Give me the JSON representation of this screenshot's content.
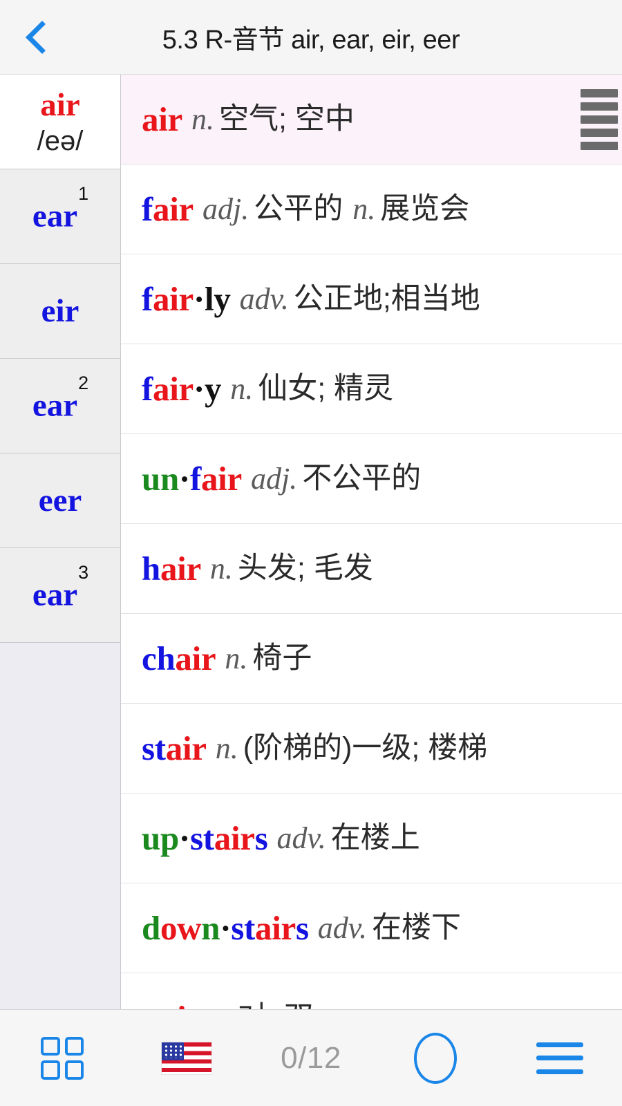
{
  "header": {
    "back_icon": "chevron-left-icon",
    "title": "5.3 R-音节 air, ear, eir, eer"
  },
  "sidebar": {
    "items": [
      {
        "label": "air",
        "sup": "",
        "phonetic": "/eə/",
        "active": true
      },
      {
        "label": "ear",
        "sup": "1",
        "phonetic": "",
        "active": false
      },
      {
        "label": "eir",
        "sup": "",
        "phonetic": "",
        "active": false
      },
      {
        "label": "ear",
        "sup": "2",
        "phonetic": "",
        "active": false
      },
      {
        "label": "eer",
        "sup": "",
        "phonetic": "",
        "active": false
      },
      {
        "label": "ear",
        "sup": "3",
        "phonetic": "",
        "active": false
      }
    ]
  },
  "list": {
    "rows": [
      {
        "selected": true,
        "word_parts": [
          {
            "t": "air",
            "c": "red"
          }
        ],
        "entries": [
          {
            "pos": "n.",
            "mean": "空气; 空中"
          }
        ]
      },
      {
        "selected": false,
        "word_parts": [
          {
            "t": "f",
            "c": "blue"
          },
          {
            "t": "air",
            "c": "red"
          }
        ],
        "entries": [
          {
            "pos": "adj.",
            "mean": "公平的"
          },
          {
            "pos": "n.",
            "mean": "展览会"
          }
        ]
      },
      {
        "selected": false,
        "word_parts": [
          {
            "t": "f",
            "c": "blue"
          },
          {
            "t": "air",
            "c": "red"
          },
          {
            "t": "·",
            "c": "dot"
          },
          {
            "t": "ly",
            "c": "black"
          }
        ],
        "entries": [
          {
            "pos": "adv.",
            "mean": "公正地;相当地"
          }
        ]
      },
      {
        "selected": false,
        "word_parts": [
          {
            "t": "f",
            "c": "blue"
          },
          {
            "t": "air",
            "c": "red"
          },
          {
            "t": "·",
            "c": "dot"
          },
          {
            "t": "y",
            "c": "black"
          }
        ],
        "entries": [
          {
            "pos": "n.",
            "mean": "仙女; 精灵"
          }
        ]
      },
      {
        "selected": false,
        "word_parts": [
          {
            "t": "un",
            "c": "green"
          },
          {
            "t": "·",
            "c": "dot"
          },
          {
            "t": "f",
            "c": "blue"
          },
          {
            "t": "air",
            "c": "red"
          }
        ],
        "entries": [
          {
            "pos": "adj.",
            "mean": "不公平的"
          }
        ]
      },
      {
        "selected": false,
        "word_parts": [
          {
            "t": "h",
            "c": "blue"
          },
          {
            "t": "air",
            "c": "red"
          }
        ],
        "entries": [
          {
            "pos": "n.",
            "mean": "头发; 毛发"
          }
        ]
      },
      {
        "selected": false,
        "word_parts": [
          {
            "t": "ch",
            "c": "blue"
          },
          {
            "t": "air",
            "c": "red"
          }
        ],
        "entries": [
          {
            "pos": "n.",
            "mean": "椅子"
          }
        ]
      },
      {
        "selected": false,
        "word_parts": [
          {
            "t": "st",
            "c": "blue"
          },
          {
            "t": "air",
            "c": "red"
          }
        ],
        "entries": [
          {
            "pos": "n.",
            "mean": "(阶梯的)一级; 楼梯"
          }
        ]
      },
      {
        "selected": false,
        "word_parts": [
          {
            "t": "up",
            "c": "green"
          },
          {
            "t": "·",
            "c": "dot"
          },
          {
            "t": "st",
            "c": "blue"
          },
          {
            "t": "air",
            "c": "red"
          },
          {
            "t": "s",
            "c": "blue"
          }
        ],
        "entries": [
          {
            "pos": "adv.",
            "mean": "在楼上"
          }
        ]
      },
      {
        "selected": false,
        "word_parts": [
          {
            "t": "d",
            "c": "green"
          },
          {
            "t": "ow",
            "c": "red"
          },
          {
            "t": "n",
            "c": "green"
          },
          {
            "t": "·",
            "c": "dot"
          },
          {
            "t": "st",
            "c": "blue"
          },
          {
            "t": "air",
            "c": "red"
          },
          {
            "t": "s",
            "c": "blue"
          }
        ],
        "entries": [
          {
            "pos": "adv.",
            "mean": "在楼下"
          }
        ]
      },
      {
        "selected": false,
        "word_parts": [
          {
            "t": "p",
            "c": "blue"
          },
          {
            "t": "air",
            "c": "red"
          }
        ],
        "entries": [
          {
            "pos": "n.",
            "mean": "对, 双"
          }
        ]
      }
    ],
    "drag_handle_icon": "drag-handle-icon"
  },
  "bottombar": {
    "grid_icon": "grid-icon",
    "flag_icon": "us-flag-icon",
    "counter": "0/12",
    "circle_icon": "circle-icon",
    "menu_icon": "hamburger-menu-icon"
  },
  "colors": {
    "accent_blue": "#1a86e8",
    "word_red": "#e8151b",
    "word_blue": "#1414e0",
    "word_green": "#1a8a1f",
    "selected_row_bg": "#fcf2f9",
    "header_bg": "#f5f5f6",
    "sidebar_bg": "#eeeeee"
  }
}
